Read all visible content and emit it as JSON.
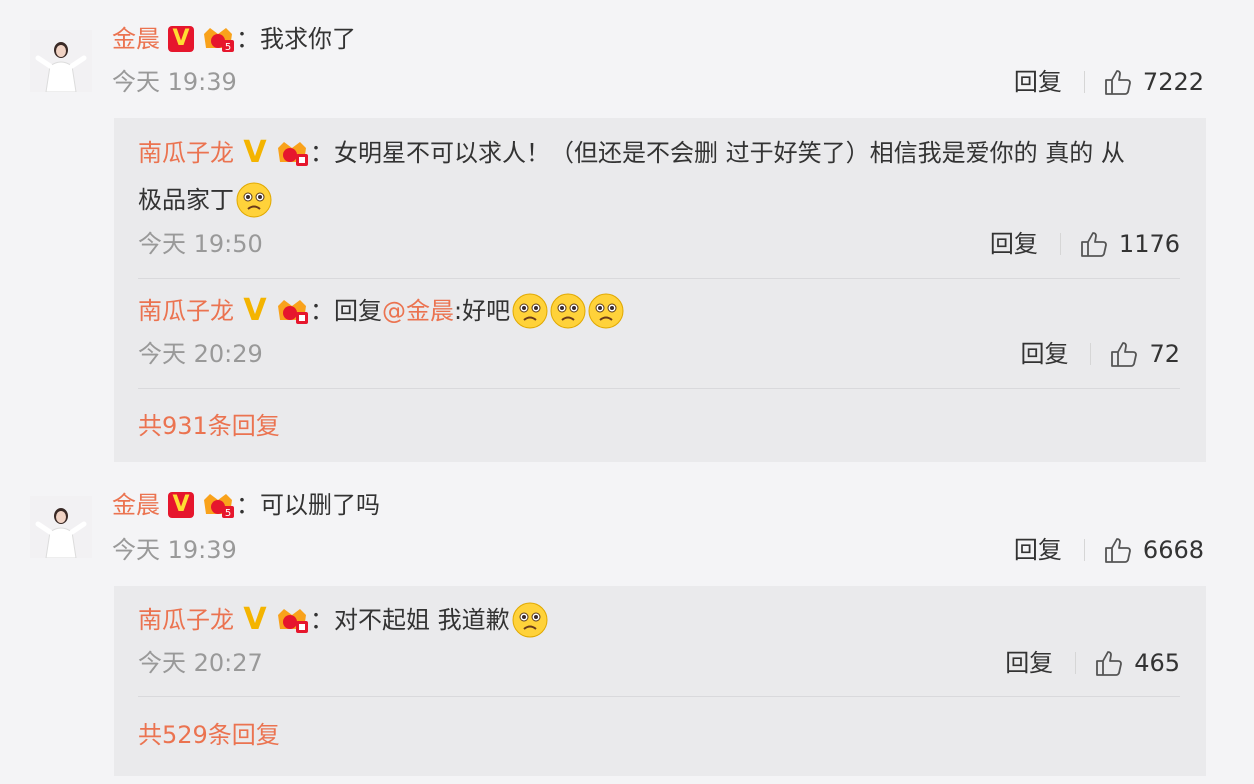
{
  "colors": {
    "name": "#eb7350",
    "time": "#999999",
    "reply_bg": "#eaeaec",
    "vip_red": "#e6162d",
    "v_gold": "#f4b400"
  },
  "comments": [
    {
      "author": "金晨",
      "text": "：我求你了",
      "time": "今天 19:39",
      "reply_label": "回复",
      "likes": "7222",
      "replies": [
        {
          "author": "南瓜子龙",
          "text_line1": "：女明星不可以求人！（但还是不会删 过于好笑了）相信我是爱你的 真的 从",
          "text_line2": "极品家丁",
          "time": "今天 19:50",
          "reply_label": "回复",
          "likes": "1176"
        },
        {
          "author": "南瓜子龙",
          "text_pre": "：回复",
          "mention": "@金晨",
          "text_post": ":好吧",
          "time": "今天 20:29",
          "reply_label": "回复",
          "likes": "72"
        }
      ],
      "more_replies": "共931条回复"
    },
    {
      "author": "金晨",
      "text": "：可以删了吗",
      "time": "今天 19:39",
      "reply_label": "回复",
      "likes": "6668",
      "replies": [
        {
          "author": "南瓜子龙",
          "text": "：对不起姐 我道歉",
          "time": "今天 20:27",
          "reply_label": "回复",
          "likes": "465"
        }
      ],
      "more_replies": "共529条回复"
    }
  ]
}
